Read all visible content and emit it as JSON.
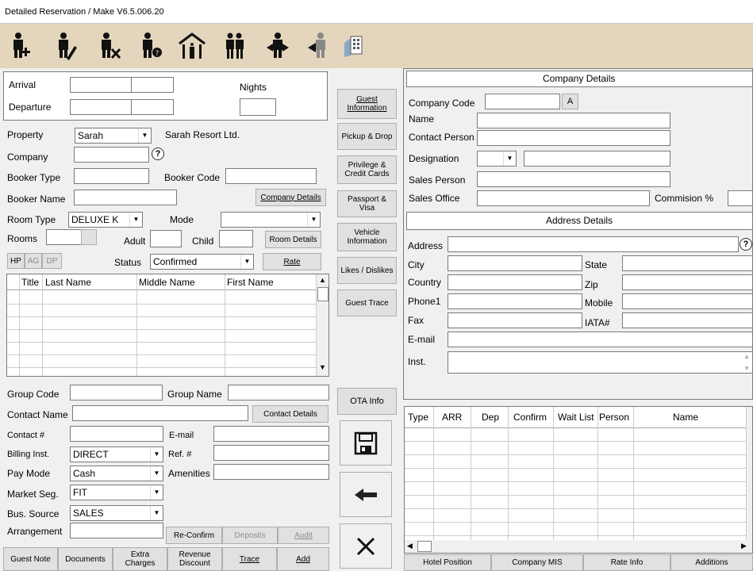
{
  "window": {
    "title": "Detailed Reservation / Make V6.5.006.20"
  },
  "toolbar": {
    "icons": [
      "add-guest-icon",
      "edit-guest-icon",
      "delete-guest-icon",
      "guest-query-icon",
      "hotel-icon",
      "group-guests-icon",
      "checkout-guest-icon",
      "guest-walk-icon",
      "room-rack-icon"
    ]
  },
  "stay": {
    "arrival_label": "Arrival",
    "departure_label": "Departure",
    "nights_label": "Nights"
  },
  "reservation": {
    "property_label": "Property",
    "property_value": "Sarah",
    "property_name": "Sarah Resort Ltd.",
    "company_label": "Company",
    "booker_type_label": "Booker Type",
    "booker_code_label": "Booker Code",
    "booker_name_label": "Booker Name",
    "company_details_btn": "Company Details",
    "room_type_label": "Room Type",
    "room_type_value": "DELUXE K",
    "mode_label": "Mode",
    "rooms_label": "Rooms",
    "adult_label": "Adult",
    "child_label": "Child",
    "room_details_btn": "Room Details",
    "hp_btn": "HP",
    "ag_btn": "AG",
    "dp_btn": "DP",
    "status_label": "Status",
    "status_value": "Confirmed",
    "rate_btn": "Rate"
  },
  "guests_table": {
    "columns": [
      "Title",
      "Last Name",
      "Middle Name",
      "First Name"
    ]
  },
  "group": {
    "group_code_label": "Group Code",
    "group_name_label": "Group Name",
    "contact_name_label": "Contact Name",
    "contact_details_btn": "Contact Details",
    "contact_no_label": "Contact #",
    "email_label": "E-mail",
    "billing_label": "Billing Inst.",
    "billing_value": "DIRECT",
    "ref_label": "Ref. #",
    "pay_mode_label": "Pay Mode",
    "pay_mode_value": "Cash",
    "amenities_label": "Amenities",
    "market_seg_label": "Market Seg.",
    "market_seg_value": "FIT",
    "bus_source_label": "Bus. Source",
    "bus_source_value": "SALES",
    "arrangement_label": "Arrangement",
    "reconfirm_btn": "Re-Confirm",
    "deposits_btn": "Deposits",
    "audit_btn": "Audit"
  },
  "bottom_buttons": [
    "Guest Note",
    "Documents",
    "Extra Charges",
    "Revenue Discount",
    "Trace",
    "Add"
  ],
  "side_buttons": [
    "Guest Information",
    "Pickup & Drop",
    "Privilege & Credit Cards",
    "Passport & Visa",
    "Vehicle Information",
    "Likes / Dislikes",
    "Guest Trace",
    "OTA Info"
  ],
  "company": {
    "section_title": "Company Details",
    "company_code_label": "Company Code",
    "a_btn": "A",
    "name_label": "Name",
    "contact_person_label": "Contact Person",
    "designation_label": "Designation",
    "sales_person_label": "Sales Person",
    "sales_office_label": "Sales Office",
    "commission_label": "Commision %"
  },
  "address": {
    "section_title": "Address Details",
    "address_label": "Address",
    "city_label": "City",
    "state_label": "State",
    "country_label": "Country",
    "zip_label": "Zip",
    "phone1_label": "Phone1",
    "mobile_label": "Mobile",
    "fax_label": "Fax",
    "iata_label": "IATA#",
    "email_label": "E-mail",
    "inst_label": "Inst."
  },
  "booking_table": {
    "columns": [
      "Type",
      "ARR",
      "Dep",
      "Confirm",
      "Wait List",
      "Person",
      "Name"
    ]
  },
  "bottom_tabs": [
    "Hotel Position",
    "Company MIS",
    "Rate Info",
    "Additions"
  ]
}
